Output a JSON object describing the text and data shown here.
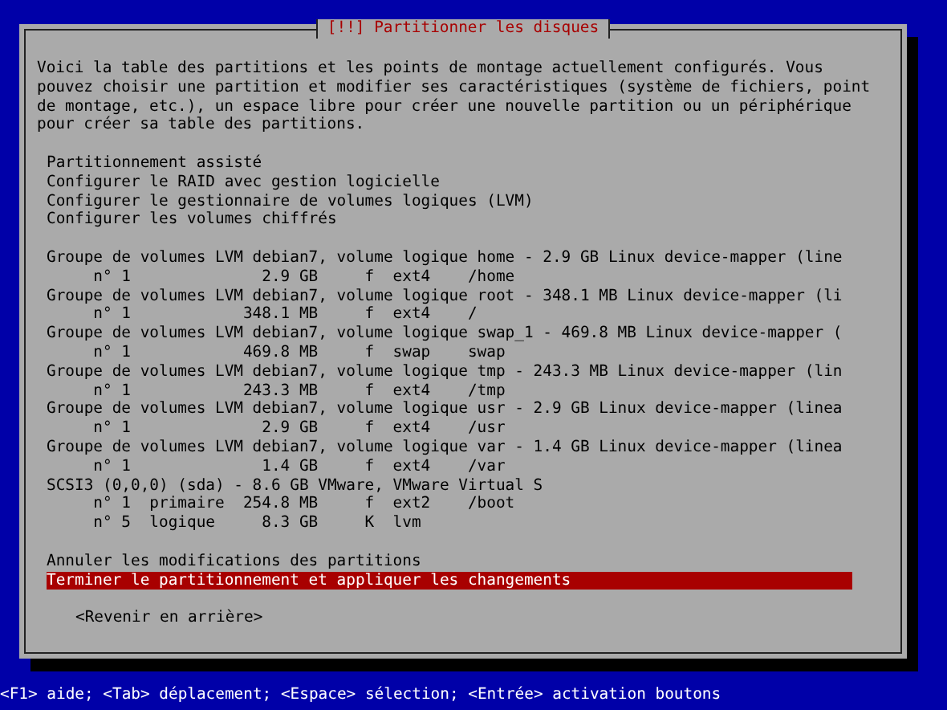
{
  "dialog": {
    "title": "[!!] Partitionner les disques",
    "intro": "Voici la table des partitions et les points de montage actuellement configurés. Vous\npouvez choisir une partition et modifier ses caractéristiques (système de fichiers, point\nde montage, etc.), un espace libre pour créer une nouvelle partition ou un périphérique\npour créer sa table des partitions.",
    "menu_groups": [
      [
        {
          "text": "Partitionnement assisté",
          "selected": false
        },
        {
          "text": "Configurer le RAID avec gestion logicielle",
          "selected": false
        },
        {
          "text": "Configurer le gestionnaire de volumes logiques (LVM)",
          "selected": false
        },
        {
          "text": "Configurer les volumes chiffrés",
          "selected": false
        }
      ],
      [
        {
          "text": "Groupe de volumes LVM debian7, volume logique home - 2.9 GB Linux device-mapper (line",
          "selected": false
        },
        {
          "text": "     n° 1              2.9 GB     f  ext4    /home",
          "selected": false
        },
        {
          "text": "Groupe de volumes LVM debian7, volume logique root - 348.1 MB Linux device-mapper (li",
          "selected": false
        },
        {
          "text": "     n° 1            348.1 MB     f  ext4    /",
          "selected": false
        },
        {
          "text": "Groupe de volumes LVM debian7, volume logique swap_1 - 469.8 MB Linux device-mapper (",
          "selected": false
        },
        {
          "text": "     n° 1            469.8 MB     f  swap    swap",
          "selected": false
        },
        {
          "text": "Groupe de volumes LVM debian7, volume logique tmp - 243.3 MB Linux device-mapper (lin",
          "selected": false
        },
        {
          "text": "     n° 1            243.3 MB     f  ext4    /tmp",
          "selected": false
        },
        {
          "text": "Groupe de volumes LVM debian7, volume logique usr - 2.9 GB Linux device-mapper (linea",
          "selected": false
        },
        {
          "text": "     n° 1              2.9 GB     f  ext4    /usr",
          "selected": false
        },
        {
          "text": "Groupe de volumes LVM debian7, volume logique var - 1.4 GB Linux device-mapper (linea",
          "selected": false
        },
        {
          "text": "     n° 1              1.4 GB     f  ext4    /var",
          "selected": false
        },
        {
          "text": "SCSI3 (0,0,0) (sda) - 8.6 GB VMware, VMware Virtual S",
          "selected": false
        },
        {
          "text": "     n° 1  primaire  254.8 MB     f  ext2    /boot",
          "selected": false
        },
        {
          "text": "     n° 5  logique     8.3 GB     K  lvm",
          "selected": false
        }
      ],
      [
        {
          "text": "Annuler les modifications des partitions",
          "selected": false
        },
        {
          "text": "Terminer le partitionnement et appliquer les changements",
          "selected": true
        }
      ]
    ],
    "back_button": "<Revenir en arrière>"
  },
  "status_bar": "<F1> aide; <Tab> déplacement; <Espace> sélection; <Entrée> activation boutons"
}
